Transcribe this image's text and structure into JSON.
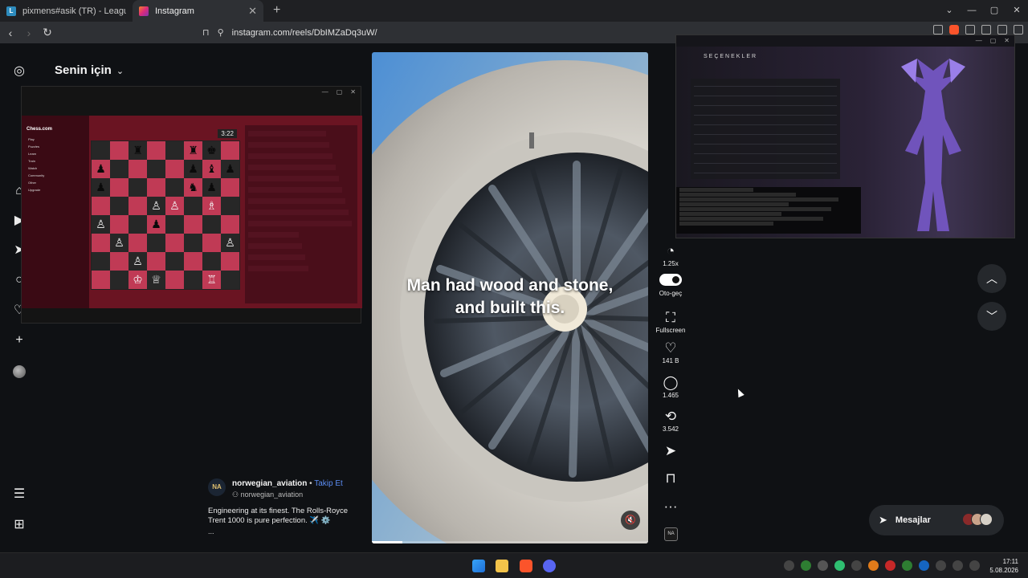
{
  "browser": {
    "tabs": [
      {
        "title": "pixmens#asik (TR) - LeagueOfGraphs",
        "active": false
      },
      {
        "title": "Instagram",
        "active": true
      }
    ],
    "url": "instagram.com/reels/DbIMZaDq3uW/"
  },
  "feed": {
    "title": "Senin için"
  },
  "chess": {
    "logo": "Chess.com",
    "menu": [
      "Play",
      "Puzzles",
      "Learn",
      "Train",
      "Watch",
      "Community",
      "Other",
      "Upgrade"
    ],
    "clock": "3:22"
  },
  "reel": {
    "caption_line1": "Man had wood and stone,",
    "caption_line2": "and built this.",
    "progress": 0.11
  },
  "actions": {
    "speed": "1.25x",
    "autoplay": "Oto-geç",
    "fullscreen": "Fullscreen",
    "likes": "141 B",
    "comments": "1.465",
    "reposts": "3.542",
    "avatar_initials": "NA"
  },
  "author": {
    "username": "norwegian_aviation",
    "follow": "Takip Et",
    "audio": "norwegian_aviation",
    "description": "Engineering at its finest. The Rolls-Royce Trent 1000 is pure perfection. ✈️ ⚙️",
    "more": "...",
    "avatar_initials": "NA"
  },
  "game": {
    "title": "SEÇENEKLER"
  },
  "messages": {
    "label": "Mesajlar"
  },
  "clock": {
    "time": "17:11",
    "date": "5.08.2026"
  }
}
